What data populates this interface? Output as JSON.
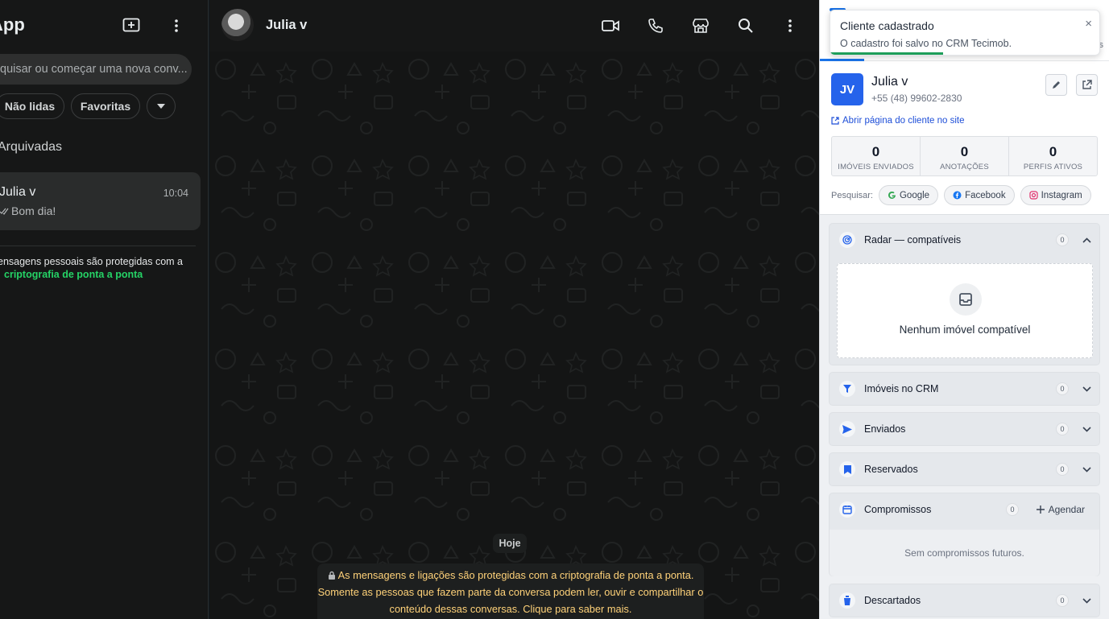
{
  "left": {
    "app_title": "App",
    "search_placeholder": "quisar ou começar uma nova conv...",
    "filters": [
      "Não lidas",
      "Favoritas"
    ],
    "archived_label": "Arquivadas",
    "chat": {
      "name": "Julia v",
      "time": "10:04",
      "last_message": "Bom dia!"
    },
    "e2e_note": "ensagens pessoais são protegidas com a",
    "e2e_link": "criptografia de ponta a ponta"
  },
  "center": {
    "contact_name": "Julia v",
    "date_chip": "Hoje",
    "system_message": "As mensagens e ligações são protegidas com a criptografia de ponta a ponta. Somente as pessoas que fazem parte da conversa podem ler, ouvir e compartilhar o conteúdo dessas conversas. Clique para saber mais."
  },
  "crm": {
    "toast": {
      "title": "Cliente cadastrado",
      "text": "O cadastro foi salvo no CRM Tecimob.",
      "close": "×",
      "progress": 0.42
    },
    "tab_right_label": "s",
    "client": {
      "initials": "JV",
      "name": "Julia v",
      "phone": "+55 (48) 99602-2830"
    },
    "site_link": "Abrir página do cliente no site",
    "stats": [
      {
        "value": "0",
        "label": "IMÓVEIS ENVIADOS"
      },
      {
        "value": "0",
        "label": "ANOTAÇÕES"
      },
      {
        "value": "0",
        "label": "PERFIS ATIVOS"
      }
    ],
    "search_label": "Pesquisar:",
    "search_links": [
      "Google",
      "Facebook",
      "Instagram"
    ],
    "sections": {
      "radar": {
        "title": "Radar — compatíveis",
        "count": "0",
        "empty": "Nenhum imóvel compatível"
      },
      "crm": {
        "title": "Imóveis no CRM",
        "count": "0"
      },
      "sent": {
        "title": "Enviados",
        "count": "0"
      },
      "reserved": {
        "title": "Reservados",
        "count": "0"
      },
      "appointments": {
        "title": "Compromissos",
        "count": "0",
        "action": "Agendar",
        "empty": "Sem compromissos futuros."
      },
      "discarded": {
        "title": "Descartados",
        "count": "0"
      }
    },
    "accent_color": "#2563eb"
  }
}
